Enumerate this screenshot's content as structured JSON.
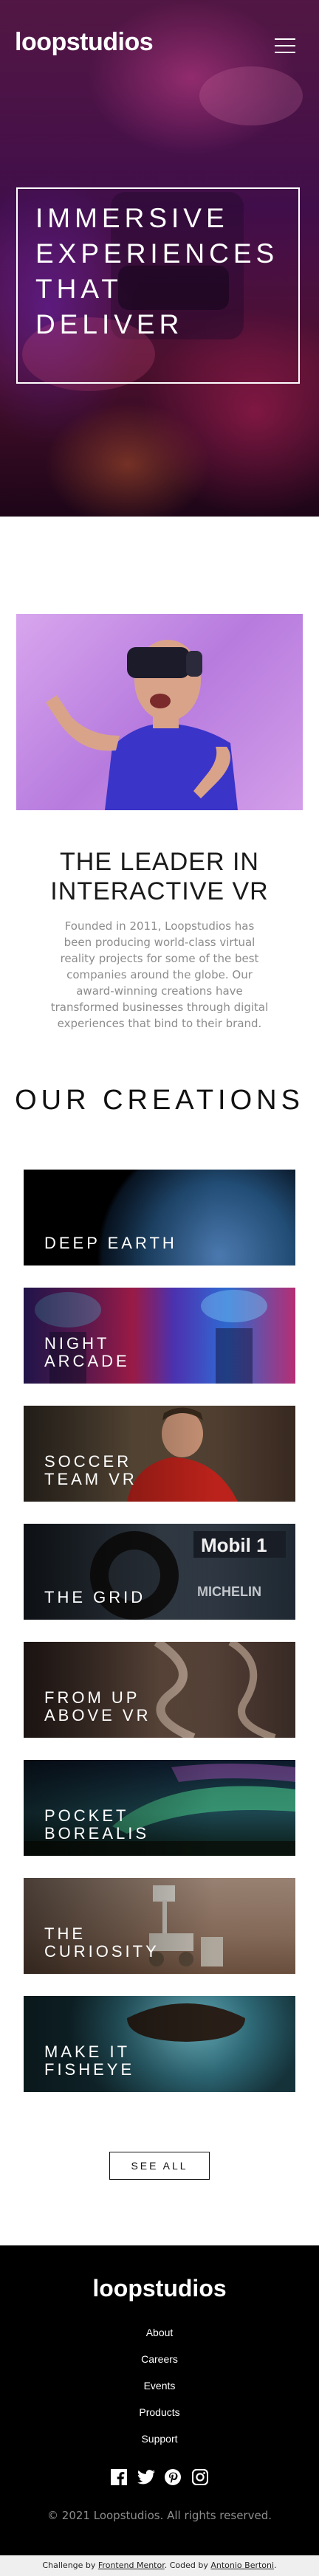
{
  "header": {
    "logo": "loopstudios",
    "menu_icon": "hamburger-icon"
  },
  "hero": {
    "title": "Immersive experiences that deliver"
  },
  "about": {
    "title": "The leader in interactive VR",
    "text": "Founded in 2011, Loopstudios has been producing world-class virtual reality projects for some of the best companies around the globe. Our award-winning creations have transformed businesses through digital experiences that bind to their brand."
  },
  "creations": {
    "title": "Our creations",
    "items": [
      {
        "title": "Deep earth"
      },
      {
        "title": "Night arcade"
      },
      {
        "title": "Soccer team VR"
      },
      {
        "title": "The grid"
      },
      {
        "title": "From up above VR"
      },
      {
        "title": "Pocket borealis"
      },
      {
        "title": "The curiosity"
      },
      {
        "title": "Make it fisheye"
      }
    ],
    "see_all": "See all"
  },
  "footer": {
    "logo": "loopstudios",
    "nav": [
      "About",
      "Careers",
      "Events",
      "Products",
      "Support"
    ],
    "socials": [
      "facebook-icon",
      "twitter-icon",
      "pinterest-icon",
      "instagram-icon"
    ],
    "copyright": "© 2021 Loopstudios. All rights reserved."
  },
  "attribution": {
    "prefix": "Challenge by ",
    "fm": "Frontend Mentor",
    "mid": ". Coded by ",
    "author": "Antonio Bertoni",
    "suffix": "."
  },
  "colors": {
    "black": "#000000",
    "gray": "#8c8c8c",
    "white": "#ffffff"
  }
}
